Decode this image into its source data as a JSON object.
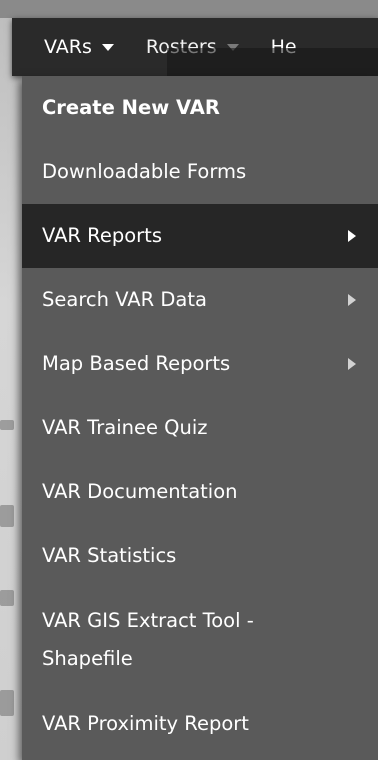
{
  "navbar": {
    "items": [
      {
        "label": "VARs"
      },
      {
        "label": "Rosters"
      },
      {
        "label": "He"
      }
    ]
  },
  "menu": {
    "items": [
      {
        "label": "Create New VAR"
      },
      {
        "label": "Downloadable Forms"
      },
      {
        "label": "VAR Reports",
        "submenu": true
      },
      {
        "label": "Search VAR Data",
        "submenu": true
      },
      {
        "label": "Map Based Reports",
        "submenu": true
      },
      {
        "label": "VAR Trainee Quiz"
      },
      {
        "label": "VAR Documentation"
      },
      {
        "label": "VAR Statistics"
      },
      {
        "label": "VAR GIS Extract Tool - Shapefile"
      },
      {
        "label": "VAR Proximity Report"
      }
    ]
  },
  "colors": {
    "navbar": "#2a2a2a",
    "dropdown": "#5a5a5a",
    "active_item": "#262626",
    "text": "#ffffff"
  },
  "icons": {
    "dropdown_caret": "caret-down-icon",
    "submenu_arrow": "chevron-right-icon"
  }
}
